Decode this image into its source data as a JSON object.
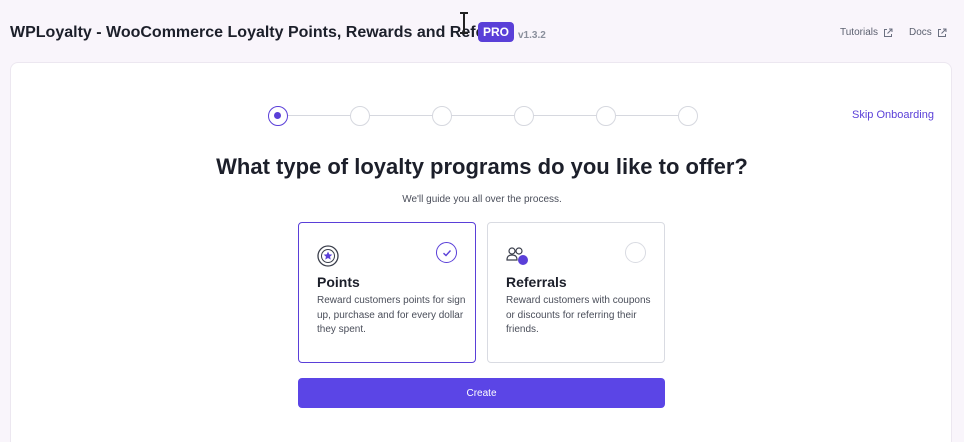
{
  "header": {
    "title": "WPLoyalty - WooCommerce Loyalty Points, Rewards and Referral",
    "badge": "PRO",
    "version": "v1.3.2",
    "links": [
      {
        "label": "Tutorials",
        "icon": "external-link-icon"
      },
      {
        "label": "Docs",
        "icon": "external-link-icon"
      }
    ]
  },
  "onboarding": {
    "steps_total": 6,
    "current_step": 1,
    "skip_label": "Skip Onboarding",
    "heading": "What type of loyalty programs do you like to offer?",
    "subheading": "We'll guide you all over the process.",
    "options": [
      {
        "title": "Points",
        "description": "Reward customers points for sign up, purchase and for every dollar they spent.",
        "icon": "star-badge-icon",
        "selected": true
      },
      {
        "title": "Referrals",
        "description": "Reward customers with coupons or discounts for referring their friends.",
        "icon": "users-icon",
        "selected": false
      }
    ],
    "create_label": "Create"
  },
  "colors": {
    "accent": "#5a3fd8",
    "button": "#5b45e6",
    "background": "#f9f5fb"
  }
}
